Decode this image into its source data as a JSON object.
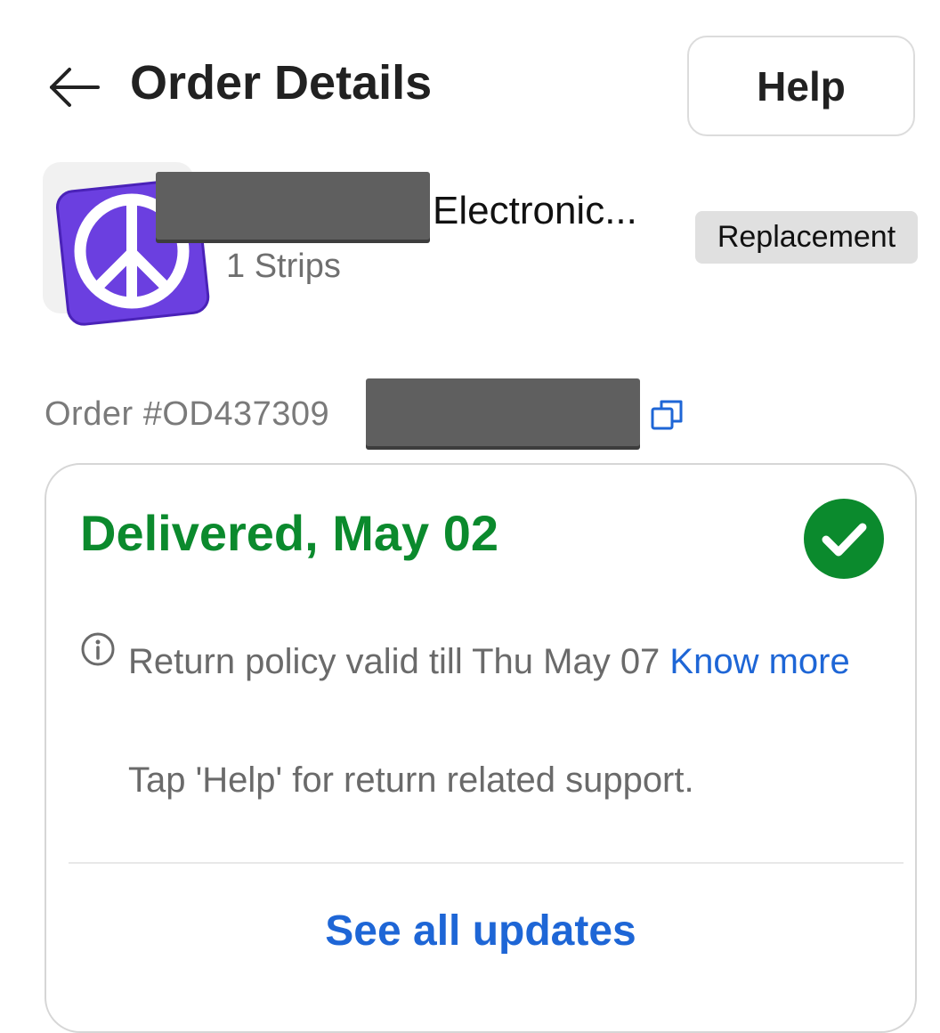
{
  "header": {
    "title": "Order Details",
    "help_label": "Help"
  },
  "product": {
    "name_suffix": "Electronic...",
    "quantity": "1 Strips",
    "badge": "Replacement"
  },
  "order": {
    "id_visible": "Order #OD437309"
  },
  "card": {
    "status": "Delivered, May 02",
    "policy_text": "Return policy valid till Thu May 07 ",
    "know_more": "Know more",
    "tap_help": "Tap 'Help' for return related support.",
    "see_all": "See all updates"
  },
  "colors": {
    "status_green": "#0b8a2d",
    "link_blue": "#1e66d6",
    "badge_bg": "#e0e0e0",
    "thumb_purple": "#6b3fe0"
  },
  "icons": {
    "back": "arrow-left-icon",
    "copy": "copy-icon",
    "status": "check-circle-icon",
    "info": "info-icon",
    "thumb": "peace-sign-icon"
  }
}
